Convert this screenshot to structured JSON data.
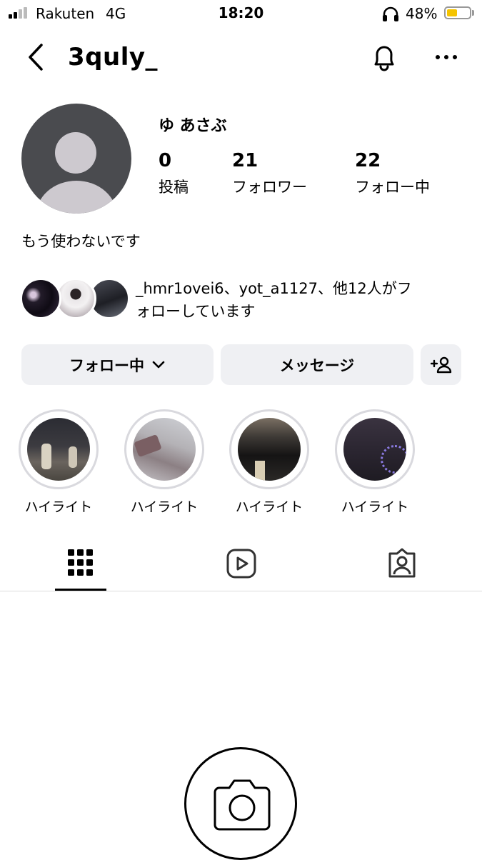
{
  "status_bar": {
    "carrier": "Rakuten",
    "network": "4G",
    "time": "18:20",
    "battery_pct": "48%",
    "battery_level": 0.48,
    "battery_color": "#f5c400"
  },
  "header": {
    "back_icon": "chevron-left-icon",
    "username": "3quly_",
    "notification_icon": "bell-icon",
    "more_icon": "more-horizontal-icon"
  },
  "profile": {
    "display_name": "ゆ あさぶ",
    "stats": [
      {
        "value": "0",
        "label": "投稿"
      },
      {
        "value": "21",
        "label": "フォロワー"
      },
      {
        "value": "22",
        "label": "フォロー中"
      }
    ],
    "bio": "もう使わないです",
    "followed_by_line1": "_hmr1ovei6、yot_a1127、他12人がフ",
    "followed_by_line2": "ォローしています"
  },
  "actions": {
    "follow_label": "フォロー中",
    "message_label": "メッセージ",
    "add_user_icon": "add-user-icon"
  },
  "highlights": [
    {
      "label": "ハイライト"
    },
    {
      "label": "ハイライト"
    },
    {
      "label": "ハイライト"
    },
    {
      "label": "ハイライト"
    }
  ],
  "tabs": [
    {
      "icon": "grid-icon",
      "active": true
    },
    {
      "icon": "reels-icon",
      "active": false
    },
    {
      "icon": "tagged-icon",
      "active": false
    }
  ],
  "empty_state_icon": "camera-icon"
}
